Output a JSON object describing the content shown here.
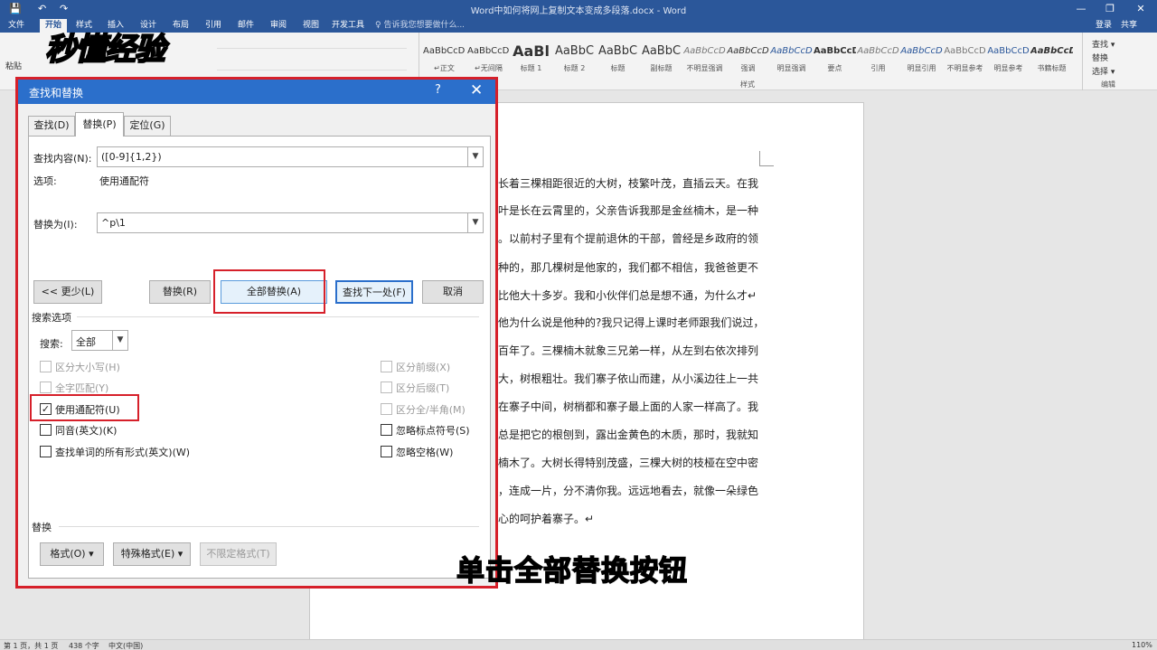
{
  "titlebar": {
    "doc_title": "Word中如何将网上复制文本变成多段落.docx - Word",
    "minimize": "—",
    "restore": "❐",
    "close": "✕",
    "quick_save": "💾",
    "quick_undo": "↶",
    "quick_redo": "↷"
  },
  "ribbon_tabs": [
    {
      "label": "文件"
    },
    {
      "label": "开始"
    },
    {
      "label": "样式"
    },
    {
      "label": "插入"
    },
    {
      "label": "设计"
    },
    {
      "label": "布局"
    },
    {
      "label": "引用"
    },
    {
      "label": "邮件"
    },
    {
      "label": "审阅"
    },
    {
      "label": "视图"
    },
    {
      "label": "开发工具"
    }
  ],
  "tellme": "♀ 告诉我您想要做什么...",
  "account": {
    "login": "登录",
    "share": "共享"
  },
  "logo_text": "秒懂经验",
  "ribbon": {
    "paste_label": "粘贴",
    "styles_group_label": "样式",
    "editing_group_label": "编辑",
    "styles": [
      {
        "sample": "AaBbCcDı",
        "name": "↵正文"
      },
      {
        "sample": "AaBbCcDı",
        "name": "↵无间隔"
      },
      {
        "sample": "AaBl",
        "name": "标题 1"
      },
      {
        "sample": "AaBbC",
        "name": "标题 2"
      },
      {
        "sample": "AaBbC",
        "name": "标题"
      },
      {
        "sample": "AaBbC",
        "name": "副标题"
      },
      {
        "sample": "AaBbCcD",
        "name": "不明显强调"
      },
      {
        "sample": "AaBbCcD",
        "name": "强调"
      },
      {
        "sample": "AaBbCcD",
        "name": "明显强调"
      },
      {
        "sample": "AaBbCcD",
        "name": "要点"
      },
      {
        "sample": "AaBbCcD",
        "name": "引用"
      },
      {
        "sample": "AaBbCcD",
        "name": "明显引用"
      },
      {
        "sample": "AaBbCcD",
        "name": "不明显参考"
      },
      {
        "sample": "AaBbCcD",
        "name": "明显参考"
      },
      {
        "sample": "AaBbCcD",
        "name": "书籍标题"
      }
    ],
    "editing": [
      {
        "label": "查找 ▾"
      },
      {
        "label": "替换"
      },
      {
        "label": "选择 ▾"
      }
    ]
  },
  "document": {
    "lines": [
      "排长着三棵相距很近的大树，枝繁叶茂，直插云天。在我",
      "枝叶是长在云霄里的，父亲告诉我那是金丝楠木，是一种",
      "钩。以前村子里有个提前退休的干部，曾经是乡政府的领",
      "他种的，那几棵树是他家的，我们都不相信，我爸爸更不",
      "纪比他大十多岁。我和小伙伴们总是想不通，为什么才↵",
      "，他为什么说是他种的?我只记得上课时老师跟我们说过，",
      "五百年了。三棵楠木就象三兄弟一样，从左到右依次排列",
      "高大，树根粗壮。我们寨子依山而建，从小溪边往上一共",
      "长在寨子中间，树梢都和寨子最上面的人家一样高了。我",
      "，总是把它的根刨到，露出金黄色的木质，那时，我就知",
      "丝楠木了。大树长得特别茂盛，三棵大树的枝桠在空中密",
      "着，连成一片，分不清你我。远远地看去，就像一朵绿色",
      "用心的呵护着寨子。↵"
    ]
  },
  "statusbar": {
    "page": "第 1 页，共 1 页",
    "words": "438 个字",
    "lang": "中文(中国)",
    "zoom": "110%"
  },
  "subtitle": "单击全部替换按钮",
  "dialog": {
    "title": "查找和替换",
    "help": "?",
    "close": "✕",
    "tabs": [
      {
        "label": "查找(D)"
      },
      {
        "label": "替换(P)"
      },
      {
        "label": "定位(G)"
      }
    ],
    "find_label": "查找内容(N):",
    "find_value": "([0-9]{1,2})",
    "options_label": "选项:",
    "options_value": "使用通配符",
    "replace_label": "替换为(I):",
    "replace_value": "^p\\1",
    "buttons": {
      "less": "<< 更少(L)",
      "replace": "替换(R)",
      "replace_all": "全部替换(A)",
      "find_next": "查找下一处(F)",
      "cancel": "取消"
    },
    "search_options_label": "搜索选项",
    "search_label": "搜索:",
    "search_value": "全部",
    "left_checks": [
      {
        "label": "区分大小写(H)",
        "checked": false,
        "enabled": false
      },
      {
        "label": "全字匹配(Y)",
        "checked": false,
        "enabled": false
      },
      {
        "label": "使用通配符(U)",
        "checked": true,
        "enabled": true
      },
      {
        "label": "同音(英文)(K)",
        "checked": false,
        "enabled": true
      },
      {
        "label": "查找单词的所有形式(英文)(W)",
        "checked": false,
        "enabled": true
      }
    ],
    "right_checks": [
      {
        "label": "区分前缀(X)",
        "checked": false,
        "enabled": false
      },
      {
        "label": "区分后缀(T)",
        "checked": false,
        "enabled": false
      },
      {
        "label": "区分全/半角(M)",
        "checked": false,
        "enabled": false
      },
      {
        "label": "忽略标点符号(S)",
        "checked": false,
        "enabled": true
      },
      {
        "label": "忽略空格(W)",
        "checked": false,
        "enabled": true
      }
    ],
    "replace_section_label": "替换",
    "format_button": "格式(O) ▾",
    "special_button": "特殊格式(E) ▾",
    "no_format_button": "不限定格式(T)",
    "check_mark": "✓"
  }
}
